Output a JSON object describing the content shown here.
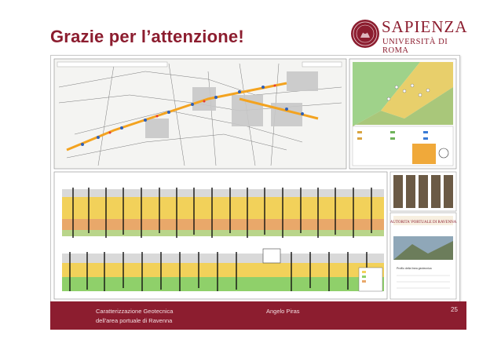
{
  "slide": {
    "title": "Grazie per l’attenzione!",
    "page_number": "25"
  },
  "logo": {
    "name_line1": "SAPIENZA",
    "name_line2": "UNIVERSITÀ DI ROMA"
  },
  "footer": {
    "course_line1": "Caratterizzazione Geotecnica",
    "course_line2": "dell'area portuale di Ravenna",
    "author": "Angelo Piras"
  },
  "figure": {
    "poster_banner": "AUTORITA' PORTUALE DI RAVENNA",
    "poster_caption": "Profilo della linea geotecnica"
  },
  "colors": {
    "brand": "#8c1d2f",
    "footer_text": "#f3dfe3"
  }
}
